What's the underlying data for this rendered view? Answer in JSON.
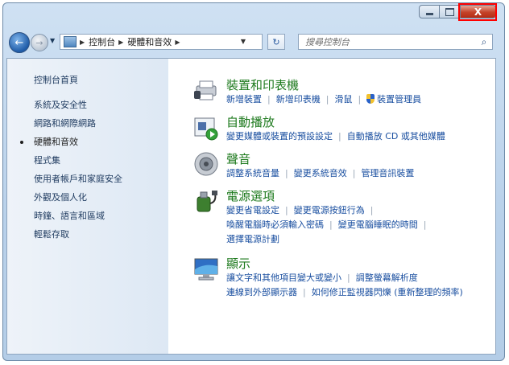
{
  "window": {
    "close_label": "關閉",
    "close_glyph": "X"
  },
  "nav": {
    "breadcrumbs": [
      "控制台",
      "硬體和音效"
    ],
    "search_placeholder": "搜尋控制台"
  },
  "sidebar": {
    "home": "控制台首頁",
    "items": [
      {
        "label": "系統及安全性",
        "active": false
      },
      {
        "label": "網路和網際網路",
        "active": false
      },
      {
        "label": "硬體和音效",
        "active": true
      },
      {
        "label": "程式集",
        "active": false
      },
      {
        "label": "使用者帳戶和家庭安全",
        "active": false
      },
      {
        "label": "外觀及個人化",
        "active": false
      },
      {
        "label": "時鐘、語言和區域",
        "active": false
      },
      {
        "label": "輕鬆存取",
        "active": false
      }
    ]
  },
  "categories": {
    "devices": {
      "title": "裝置和印表機",
      "links": [
        "新增裝置",
        "新增印表機",
        "滑鼠",
        "裝置管理員"
      ]
    },
    "autoplay": {
      "title": "自動播放",
      "links": [
        "變更媒體或裝置的預設設定",
        "自動播放 CD 或其他媒體"
      ]
    },
    "sound": {
      "title": "聲音",
      "links": [
        "調整系統音量",
        "變更系統音效",
        "管理音訊裝置"
      ]
    },
    "power": {
      "title": "電源選項",
      "links": [
        "變更省電設定",
        "變更電源按鈕行為",
        "喚醒電腦時必須輸入密碼",
        "變更電腦睡眠的時間",
        "選擇電源計劃"
      ]
    },
    "display": {
      "title": "顯示",
      "links": [
        "讓文字和其他項目變大或變小",
        "調整螢幕解析度",
        "連線到外部顯示器",
        "如何修正監視器閃爍 (重新整理的頻率)"
      ]
    }
  }
}
